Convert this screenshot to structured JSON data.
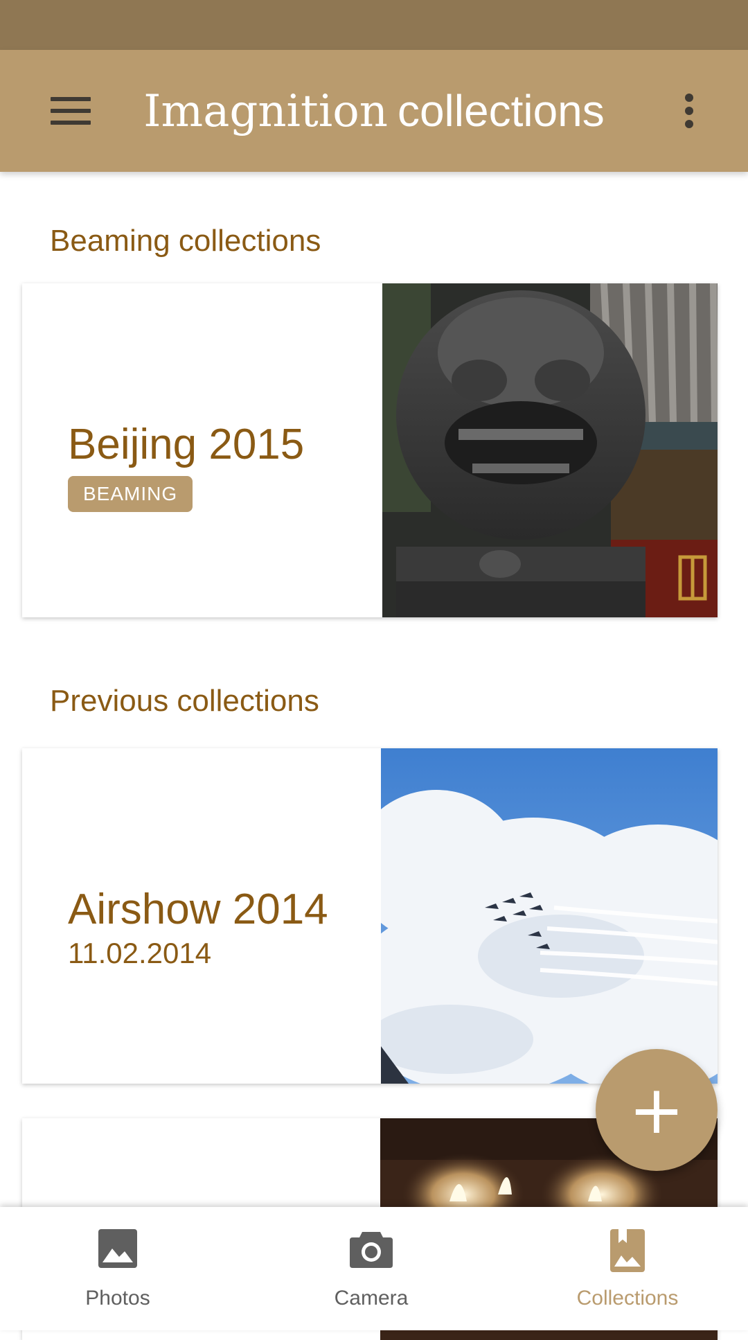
{
  "app_bar": {
    "title_part1": "Imagnition",
    "title_part2": "collections",
    "menu_icon": "hamburger-menu-icon",
    "more_icon": "more-vert-icon"
  },
  "sections": {
    "beaming": {
      "title": "Beaming collections",
      "cards": [
        {
          "title": "Beijing 2015",
          "badge": "BEAMING",
          "image": "guardian-lion-statue-photo"
        }
      ]
    },
    "previous": {
      "title": "Previous collections",
      "cards": [
        {
          "title": "Airshow 2014",
          "date": "11.02.2014",
          "image": "airshow-jets-clouds-photo"
        },
        {
          "title": "",
          "image": "candles-photo"
        }
      ]
    }
  },
  "fab": {
    "label": "+",
    "icon": "add-icon"
  },
  "bottom_nav": {
    "items": [
      {
        "label": "Photos",
        "icon": "photo-icon",
        "active": false
      },
      {
        "label": "Camera",
        "icon": "camera-icon",
        "active": false
      },
      {
        "label": "Collections",
        "icon": "collections-bookmark-icon",
        "active": true
      }
    ]
  },
  "colors": {
    "status_bar": "#8f7753",
    "app_bar": "#b99b6e",
    "accent_text": "#8a5a14",
    "nav_inactive": "#5f5f5f",
    "nav_active": "#b99b6e"
  }
}
